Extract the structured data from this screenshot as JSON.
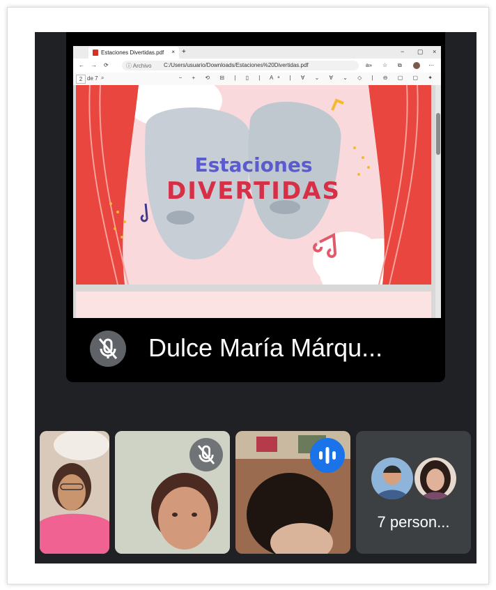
{
  "browser": {
    "tab_title": "Estaciones Divertidas.pdf",
    "tab_close": "×",
    "new_tab": "+",
    "win_min": "−",
    "win_max": "▢",
    "win_close": "×",
    "info_label": "ⓘ Archivo",
    "url": "C:/Users/usuario/Downloads/Estaciones%20Divertidas.pdf",
    "page_number": "2",
    "page_of": "de 7"
  },
  "slide": {
    "title_line1": "Estaciones",
    "title_line2": "DIVERTIDAS"
  },
  "presenter": {
    "name": "Dulce María Márqu..."
  },
  "others": {
    "label": "7 person..."
  },
  "colors": {
    "curtain": "#e8463e",
    "meet_bg": "#202124",
    "talk_badge": "#1a73e8"
  }
}
